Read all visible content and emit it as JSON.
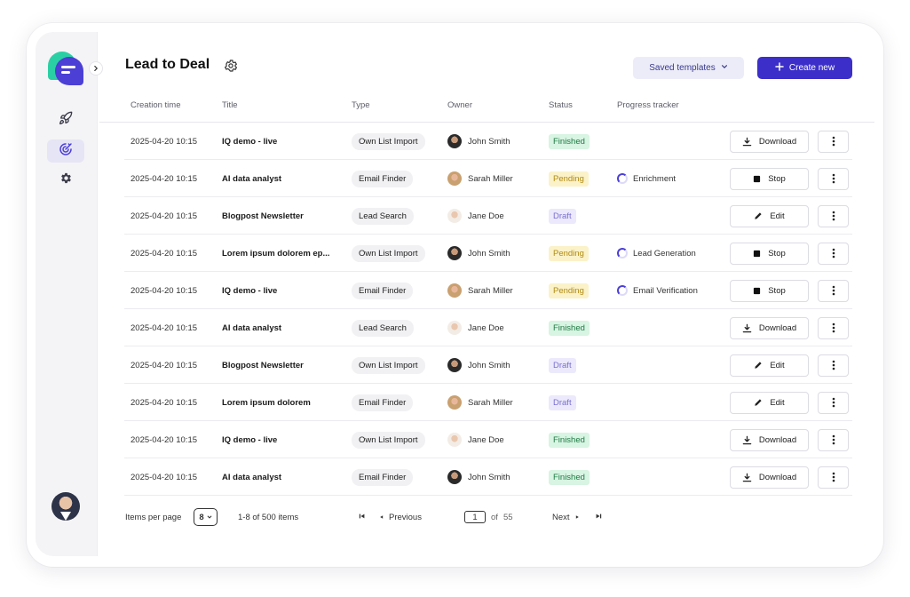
{
  "header": {
    "title": "Lead to Deal",
    "saved_templates_label": "Saved templates",
    "create_new_label": "Create new"
  },
  "sidebar": {
    "items": [
      {
        "icon": "rocket-icon"
      },
      {
        "icon": "target-icon",
        "active": true
      },
      {
        "icon": "gear-icon"
      }
    ]
  },
  "table": {
    "columns": [
      "Creation time",
      "Title",
      "Type",
      "Owner",
      "Status",
      "Progress tracker"
    ],
    "rows": [
      {
        "time": "2025-04-20 10:15",
        "title": "IQ demo - live",
        "type": "Own List Import",
        "owner": "John Smith",
        "status": "Finished",
        "progress": "",
        "action": "Download"
      },
      {
        "time": "2025-04-20 10:15",
        "title": "AI data analyst",
        "type": "Email Finder",
        "owner": "Sarah Miller",
        "status": "Pending",
        "progress": "Enrichment",
        "action": "Stop"
      },
      {
        "time": "2025-04-20 10:15",
        "title": "Blogpost Newsletter",
        "type": "Lead Search",
        "owner": "Jane Doe",
        "status": "Draft",
        "progress": "",
        "action": "Edit"
      },
      {
        "time": "2025-04-20 10:15",
        "title": "Lorem ipsum dolorem ep...",
        "type": "Own List Import",
        "owner": "John Smith",
        "status": "Pending",
        "progress": "Lead Generation",
        "action": "Stop"
      },
      {
        "time": "2025-04-20 10:15",
        "title": "IQ demo - live",
        "type": "Email Finder",
        "owner": "Sarah Miller",
        "status": "Pending",
        "progress": "Email Verification",
        "action": "Stop"
      },
      {
        "time": "2025-04-20 10:15",
        "title": "AI data analyst",
        "type": "Lead Search",
        "owner": "Jane Doe",
        "status": "Finished",
        "progress": "",
        "action": "Download"
      },
      {
        "time": "2025-04-20 10:15",
        "title": "Blogpost Newsletter",
        "type": "Own List Import",
        "owner": "John Smith",
        "status": "Draft",
        "progress": "",
        "action": "Edit"
      },
      {
        "time": "2025-04-20 10:15",
        "title": "Lorem ipsum dolorem",
        "type": "Email Finder",
        "owner": "Sarah Miller",
        "status": "Draft",
        "progress": "",
        "action": "Edit"
      },
      {
        "time": "2025-04-20 10:15",
        "title": "IQ demo - live",
        "type": "Own List Import",
        "owner": "Jane Doe",
        "status": "Finished",
        "progress": "",
        "action": "Download"
      },
      {
        "time": "2025-04-20 10:15",
        "title": "AI data analyst",
        "type": "Email Finder",
        "owner": "John Smith",
        "status": "Finished",
        "progress": "",
        "action": "Download"
      }
    ]
  },
  "pagination": {
    "items_per_page_label": "Items per page",
    "items_per_page_value": "8",
    "range_text": "1-8 of 500 items",
    "previous_label": "Previous",
    "current_page": "1",
    "of_label": "of",
    "total_pages": "55",
    "next_label": "Next"
  },
  "colors": {
    "accent": "#3c2fc9",
    "finished": "#1f7a44",
    "pending": "#b08a12",
    "draft": "#7a70d0"
  }
}
